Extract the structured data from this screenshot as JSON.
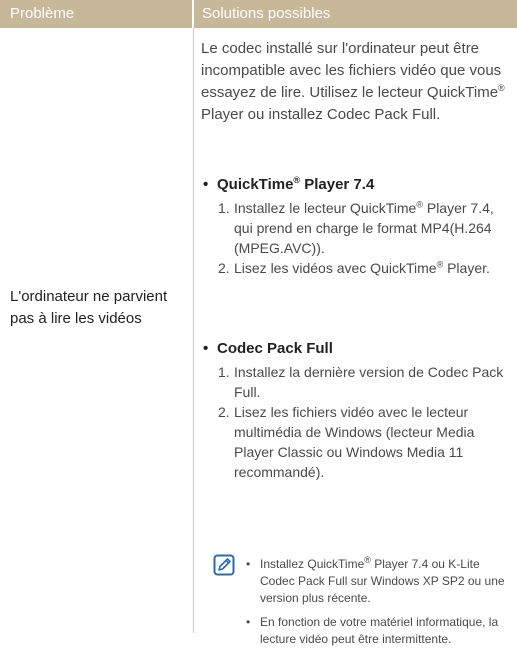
{
  "header": {
    "col_problem": "Problème",
    "col_solutions": "Solutions possibles"
  },
  "problem": "L'ordinateur ne parvient pas à lire les vidéos",
  "intro": "Le codec installé sur l'ordinateur peut être incompatible avec les fichiers vidéo que vous essayez de lire. Utilisez le lecteur QuickTime® Player ou installez Codec Pack Full.",
  "sections": [
    {
      "title_prefix": "QuickTime",
      "title_sup": "®",
      "title_suffix": " Player 7.4",
      "steps": [
        {
          "num": "1.",
          "text": "Installez le lecteur QuickTime® Player 7.4, qui prend en charge le format MP4(H.264 (MPEG.AVC))."
        },
        {
          "num": "2.",
          "text": "Lisez les vidéos avec QuickTime® Player."
        }
      ]
    },
    {
      "title": "Codec Pack Full",
      "steps": [
        {
          "num": "1.",
          "text": "Installez la dernière version de Codec Pack Full."
        },
        {
          "num": "2.",
          "text": "Lisez les fichiers vidéo avec le lecteur multimédia de Windows (lecteur Media Player Classic ou Windows Media 11 recommandé)."
        }
      ]
    }
  ],
  "notes": [
    "Installez QuickTime® Player 7.4 ou K-Lite Codec Pack Full sur Windows XP SP2 ou une version plus récente.",
    "En fonction de votre matériel informatique, la lecture vidéo peut être intermittente."
  ],
  "icons": {
    "note": "note-pencil-icon"
  },
  "colors": {
    "header_bg": "#c8b89a",
    "icon": "#2f6aa8"
  }
}
